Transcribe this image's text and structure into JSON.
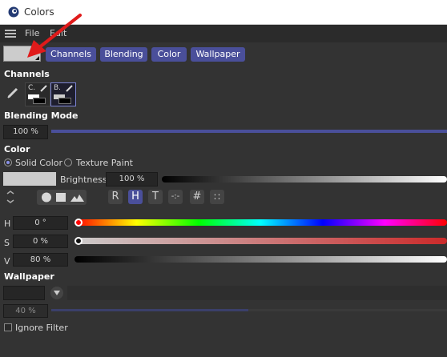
{
  "window": {
    "title": "Colors"
  },
  "menu": {
    "file": "File",
    "edit": "Edit"
  },
  "tabs": [
    "Channels",
    "Blending",
    "Color",
    "Wallpaper"
  ],
  "sections": {
    "channels": "Channels",
    "blending_mode": "Blending Mode",
    "color": "Color",
    "wallpaper": "Wallpaper"
  },
  "channels": [
    {
      "label": "C.",
      "selected": false
    },
    {
      "label": "B.",
      "selected": true
    }
  ],
  "blending": {
    "value": "100 %"
  },
  "color": {
    "mode_solid": "Solid Color",
    "mode_texture": "Texture Paint",
    "selected_mode": "Solid Color",
    "brightness_label": "Brightness",
    "brightness_value": "100 %",
    "swatch_color": "#cccccc"
  },
  "mode_buttons": [
    "R",
    "H",
    "T",
    "-:-",
    "#",
    "∷"
  ],
  "active_mode_button": "H",
  "hsv": {
    "h_label": "H",
    "h_value": "0 °",
    "h_level": 0.0,
    "s_label": "S",
    "s_value": "0 %",
    "s_level": 0.0,
    "v_label": "V",
    "v_value": "80 %",
    "v_level": 0.8
  },
  "wallpaper": {
    "opacity_value": "40 %",
    "ignore_filter_label": "Ignore Filter"
  },
  "colors": {
    "accent": "#4a4f9a",
    "background": "#333333",
    "arrow": "#e01b1b"
  }
}
